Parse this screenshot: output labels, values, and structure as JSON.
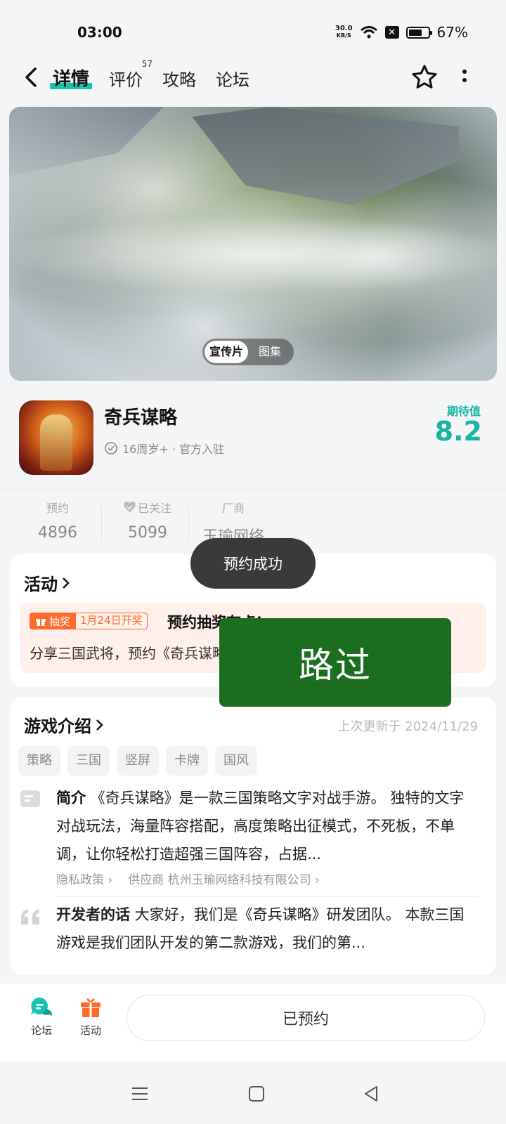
{
  "status": {
    "time": "03:00",
    "net_speed_value": "30.0",
    "net_speed_unit": "KB/S",
    "battery": "67%",
    "sim": "✕"
  },
  "nav": {
    "tabs": [
      {
        "label": "详情"
      },
      {
        "label": "评价",
        "badge": "57"
      },
      {
        "label": "攻略"
      },
      {
        "label": "论坛"
      }
    ]
  },
  "banner": {
    "toggle": [
      "宣传片",
      "图集"
    ]
  },
  "game": {
    "name": "奇兵谋略",
    "meta": "16周岁+ · 官方入驻",
    "expect_label": "期待值",
    "expect_value": "8.2"
  },
  "stats": [
    {
      "label": "预约",
      "value": "4896"
    },
    {
      "label": "已关注",
      "value": "5099"
    },
    {
      "label": "厂商",
      "value": "玉瑜网络"
    }
  ],
  "activity": {
    "title": "活动",
    "badge": "抽奖",
    "date": "1月24日开奖",
    "headline": "预约抽奖有点!",
    "desc": "分享三国武将，预约《奇兵谋略》赢好礼"
  },
  "intro": {
    "title": "游戏介绍",
    "updated": "上次更新于 2024/11/29",
    "tags": [
      "策略",
      "三国",
      "竖屏",
      "卡牌",
      "国风"
    ],
    "summary_label": "简介",
    "summary": " 《奇兵谋略》是一款三国策略文字对战手游。 独特的文字对战玩法，海量阵容搭配，高度策略出征模式，不死板，不单调，让你轻松打造超强三国阵容，占据...",
    "privacy": "隐私政策 ›",
    "supplier": "供应商 杭州玉瑜网络科技有限公司 ›",
    "dev_label": "开发者的话",
    "dev_text": " 大家好，我们是《奇兵谋略》研发团队。 本款三国游戏是我们团队开发的第二款游戏，我们的第..."
  },
  "toast": "预约成功",
  "overlay": "路过",
  "bottom": {
    "forum": "论坛",
    "activity": "活动",
    "reserved": "已预约"
  },
  "colors": {
    "accent": "#15c3b0",
    "orange": "#ff6a2b",
    "toast_bg": "#3a3a3a",
    "overlay_green": "#1c6e1f"
  }
}
